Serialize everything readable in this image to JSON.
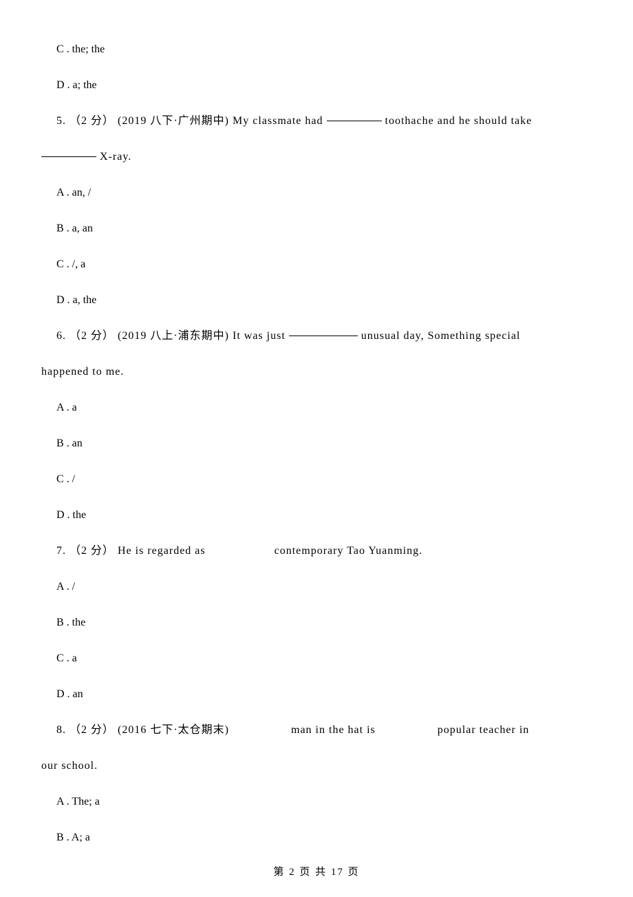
{
  "q4": {
    "optC": "C . the; the",
    "optD": "D . a; the"
  },
  "q5": {
    "stem_a": "5. （2 分） (2019 八下·广州期中) My classmate had ",
    "stem_b": " toothache and he should take",
    "stem_c": " X-ray.",
    "optA": "A . an, /",
    "optB": "B . a, an",
    "optC": "C . /, a",
    "optD": "D . a, the"
  },
  "q6": {
    "stem_a": "6. （2 分） (2019 八上·浦东期中) It was just ",
    "stem_b": " unusual day, Something special",
    "stem_c": "happened to me.",
    "optA": "A . a",
    "optB": "B . an",
    "optC": "C . /",
    "optD": "D . the"
  },
  "q7": {
    "stem_a": "7. （2 分） He is regarded as",
    "stem_b": "contemporary Tao Yuanming.",
    "optA": "A . /",
    "optB": "B . the",
    "optC": "C . a",
    "optD": "D . an"
  },
  "q8": {
    "stem_a": "8. （2 分） (2016 七下·太仓期末)",
    "stem_b": "man in the hat is",
    "stem_c": "popular teacher in",
    "stem_d": "our school.",
    "optA": "A . The; a",
    "optB": "B . A; a"
  },
  "footer": "第 2 页 共 17 页"
}
